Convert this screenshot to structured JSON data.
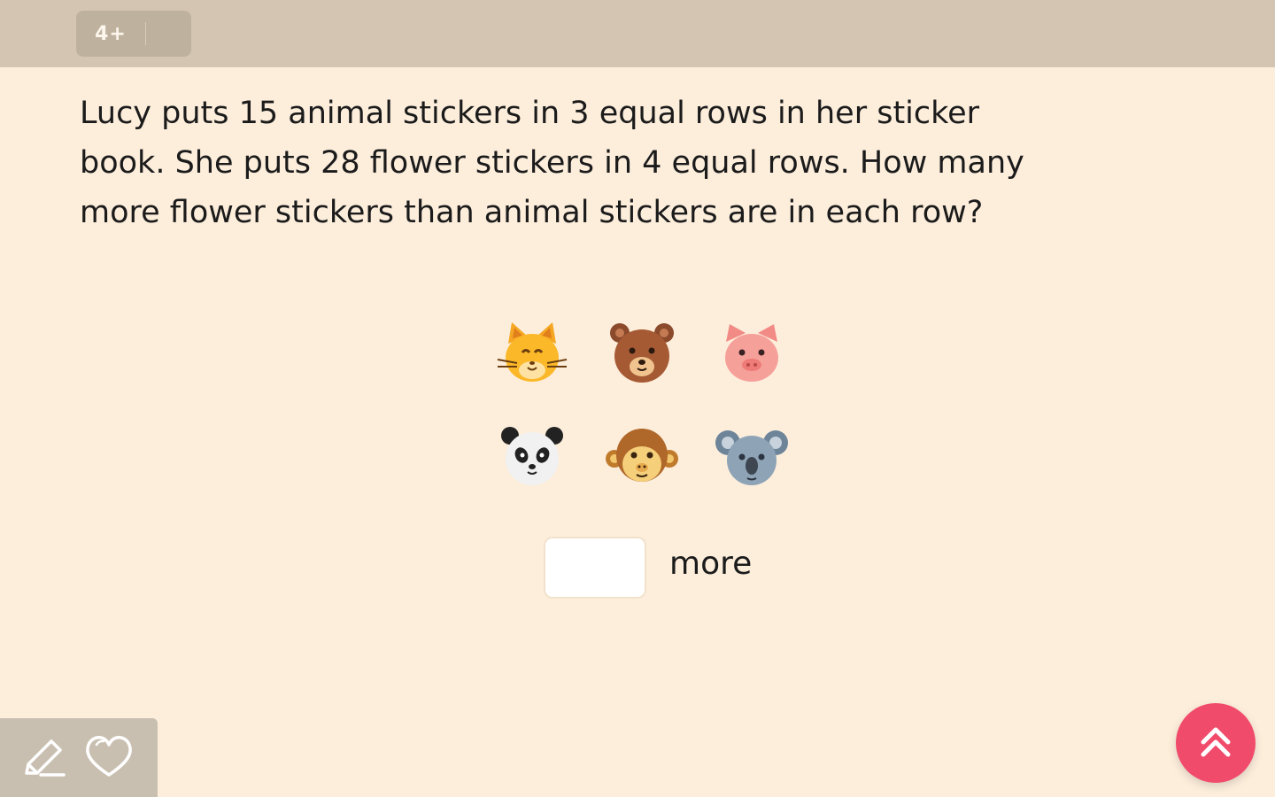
{
  "header": {
    "grade_label": "4+"
  },
  "question": {
    "text": "Lucy puts 15 animal stickers in 3 equal rows in her sticker book. She puts 28 flower stickers in 4 equal rows. How many more flower stickers than animal stickers are in each row?"
  },
  "stickers": {
    "rows": [
      [
        "cat-face-icon",
        "bear-face-icon",
        "pig-face-icon"
      ],
      [
        "panda-face-icon",
        "monkey-face-icon",
        "koala-face-icon"
      ]
    ]
  },
  "answer": {
    "value": "",
    "unit": "more"
  },
  "tools": {
    "items": [
      "pencil-icon",
      "heart-icon"
    ]
  },
  "navigation": {
    "scroll_up_icon": "double-chevron-up-icon"
  },
  "colors": {
    "background": "#fdeedc",
    "header": "#d3c5b2",
    "accent": "#f14b6c"
  }
}
